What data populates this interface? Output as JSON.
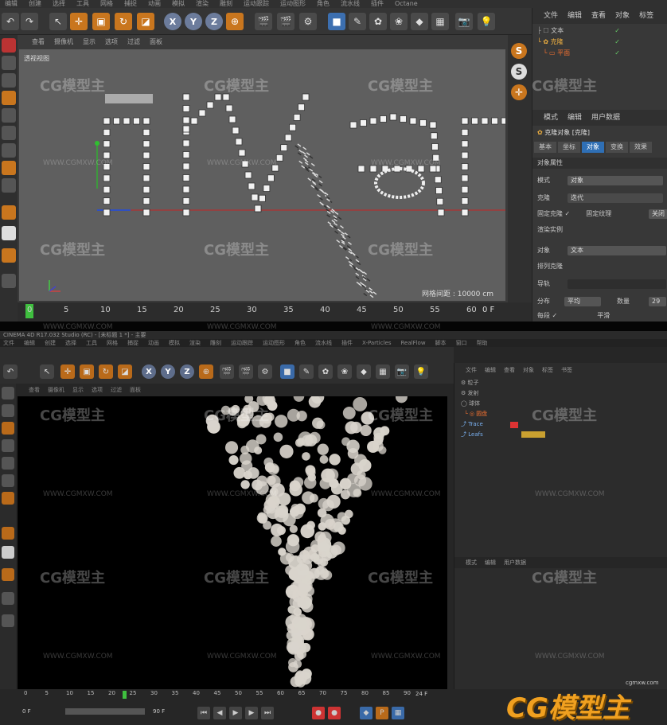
{
  "top_window": {
    "menu": [
      "编辑",
      "创建",
      "选择",
      "工具",
      "网格",
      "捕捉",
      "动画",
      "模拟",
      "渲染",
      "雕刻",
      "运动跟踪",
      "运动图形",
      "角色",
      "流水线",
      "插件",
      "Octane"
    ],
    "viewport_menu": [
      "查看",
      "摄像机",
      "显示",
      "选项",
      "过滤",
      "面板"
    ],
    "viewport_label": "透视视图",
    "grid_spacing": "网格间距 : 10000 cm",
    "axis_buttons": [
      "X",
      "Y",
      "Z"
    ],
    "snap_buttons": [
      "S",
      "S"
    ],
    "timeline_ticks": [
      "0",
      "5",
      "10",
      "15",
      "20",
      "25",
      "30",
      "35",
      "40",
      "45",
      "50",
      "55",
      "60"
    ],
    "frame_field": "0 F",
    "object_panel_menu": [
      "文件",
      "编辑",
      "查看",
      "对象",
      "标签"
    ],
    "object_tree": [
      "文本",
      "克隆",
      "平面"
    ],
    "attr_menu": [
      "模式",
      "编辑",
      "用户数据"
    ],
    "attr_object_title": "克隆对象 [克隆]",
    "attr_tabs": [
      "基本",
      "坐标",
      "对象",
      "变换",
      "效果"
    ],
    "attr_section": "对象属性",
    "mode_label": "模式",
    "mode_value": "对象",
    "clone_label": "克隆",
    "clone_value": "迭代",
    "fixed_clone": "固定克隆 ✓",
    "fixed_texture": "固定纹理",
    "fixed_texture_value": "关闭",
    "render_instances": "渲染实例",
    "object_label": "对象",
    "object_value": "文本",
    "arrange_clones": "排列克隆",
    "guide_label": "导轨",
    "distribution_label": "分布",
    "distribution_value": "平均",
    "count_label": "数量",
    "count_value": "29",
    "each_segment": "每段 ✓",
    "each_extra": "平滑"
  },
  "bottom_window": {
    "title": "CINEMA 4D R17.032 Studio (RC) - [未标题 1 *] - 主要",
    "menu": [
      "文件",
      "编辑",
      "创建",
      "选择",
      "工具",
      "网格",
      "捕捉",
      "动画",
      "模拟",
      "渲染",
      "雕刻",
      "运动跟踪",
      "运动图形",
      "角色",
      "流水线",
      "插件",
      "X-Particles",
      "RealFlow",
      "脚本",
      "窗口",
      "帮助"
    ],
    "viewport_menu": [
      "查看",
      "摄像机",
      "显示",
      "选项",
      "过滤",
      "面板"
    ],
    "axis_buttons": [
      "X",
      "Y",
      "Z"
    ],
    "object_panel_menu": [
      "文件",
      "编辑",
      "查看",
      "对象",
      "标签",
      "书签"
    ],
    "object_tree": [
      "粒子",
      "发射",
      "球体",
      "圆盘",
      "Trace",
      "Leafs"
    ],
    "attr_menu": [
      "模式",
      "编辑",
      "用户数据"
    ],
    "timeline_ticks": [
      "0",
      "5",
      "10",
      "15",
      "20",
      "25",
      "30",
      "35",
      "40",
      "45",
      "50",
      "55",
      "60",
      "65",
      "70",
      "75",
      "80",
      "85",
      "90"
    ],
    "frame_start": "0 F",
    "frame_end": "90 F",
    "frame_current": "24 F"
  },
  "watermarks": {
    "brand": "CG模型主",
    "url": "WWW.CGMXW.COM",
    "logo_url": "cgmxw.com"
  },
  "colors": {
    "accent_orange": "#c9761e",
    "accent_blue": "#2f6fb5",
    "viewport_gray": "#5f5f5f",
    "particle_white": "#d9d4cc",
    "logo_orange": "#f0a020"
  }
}
